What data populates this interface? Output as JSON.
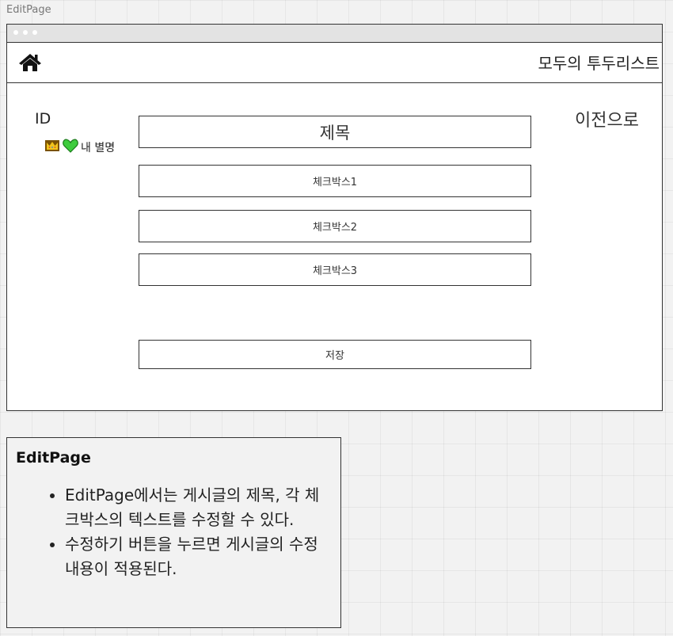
{
  "frame_label": "EditPage",
  "header": {
    "brand": "모두의 투두리스트",
    "home_icon": "home-icon"
  },
  "profile": {
    "id": "ID",
    "icons": [
      "crown-icon",
      "green-heart-icon"
    ],
    "nickname": "내 별명"
  },
  "back_label": "이전으로",
  "form": {
    "title": "제목",
    "checkboxes": [
      "체크박스1",
      "체크박스2",
      "체크박스3"
    ],
    "save_label": "저장"
  },
  "note": {
    "title": "EditPage",
    "items": [
      "EditPage에서는 게시글의 제목, 각 체크박스의 텍스트를 수정할 수 있다.",
      "수정하기 버튼을 누르면 게시글의 수정 내용이 적용된다."
    ]
  }
}
